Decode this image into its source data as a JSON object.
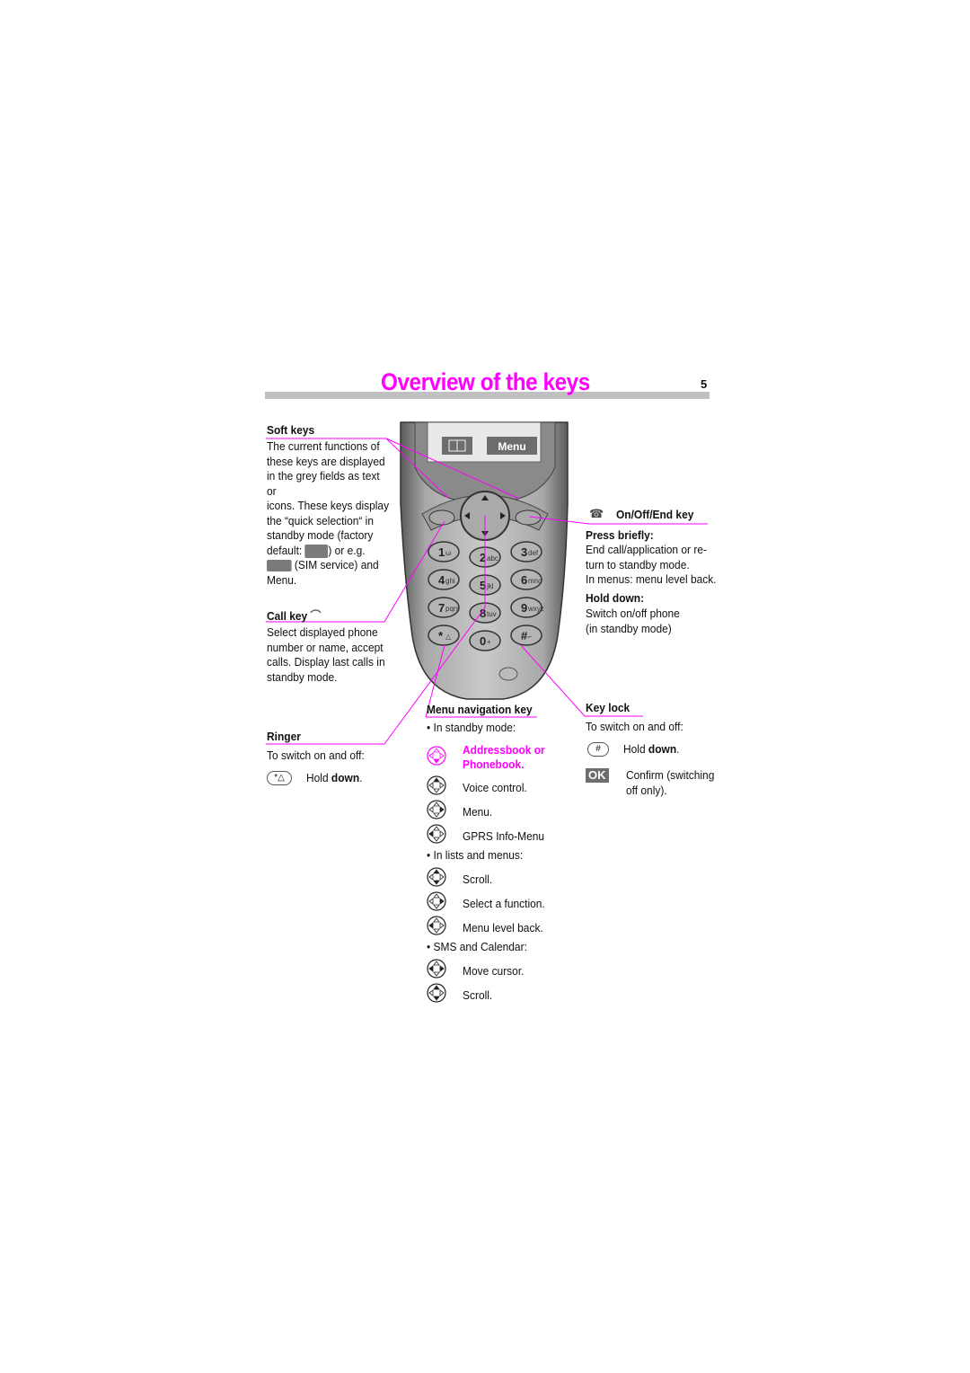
{
  "header": {
    "title": "Overview of the keys",
    "page_number": "5"
  },
  "soft_keys": {
    "heading": "Soft keys",
    "lines": [
      "The current functions of",
      "these keys are displayed",
      "in the grey fields as text or",
      "icons. These keys display",
      "the “quick selection“ in",
      "standby mode (factory"
    ],
    "default_prefix": "default:",
    "default_suffix": ") or e.g.",
    "sim_suffix": "(SIM service) and",
    "last": "Menu."
  },
  "call_key": {
    "heading": "Call key",
    "lines": [
      "Select displayed phone",
      "number or name, accept",
      "calls. Display last calls in",
      "standby mode."
    ]
  },
  "ringer": {
    "heading": "Ringer",
    "intro": "To switch on and off:",
    "action_prefix": "Hold ",
    "action_bold": "down",
    "action_suffix": "."
  },
  "phone": {
    "screen_menu_label": "Menu",
    "keys": [
      "1",
      "2",
      "3",
      "4",
      "5",
      "6",
      "7",
      "8",
      "9",
      "*",
      "0",
      "#"
    ],
    "key_letters": [
      "ω",
      "abc",
      "def",
      "ghi",
      "jkl",
      "mno",
      "pqrs",
      "tuv",
      "wxyz",
      "△",
      "+",
      "⌐"
    ]
  },
  "on_off_key": {
    "heading": "On/Off/End key",
    "press_heading": "Press briefly:",
    "press_lines": [
      "End call/application or re-",
      "turn to standby mode.",
      "In menus: menu level back."
    ],
    "hold_heading": "Hold down:",
    "hold_lines": [
      "Switch on/off phone",
      "(in standby mode)"
    ]
  },
  "key_lock": {
    "heading": "Key lock",
    "intro": "To switch on and off:",
    "hold_prefix": "Hold ",
    "hold_bold": "down",
    "hold_suffix": ".",
    "ok_label": "OK",
    "confirm_lines": [
      "Confirm (switching",
      "off only)."
    ]
  },
  "menu_nav": {
    "heading": "Menu navigation key",
    "sections": [
      {
        "bullet": "In standby mode:",
        "items": [
          {
            "dir": "down-pink",
            "label": "Addressbook or Phonebook.",
            "highlight": true
          },
          {
            "dir": "up",
            "label": "Voice control."
          },
          {
            "dir": "right",
            "label": "Menu."
          },
          {
            "dir": "left",
            "label": "GPRS Info-Menu"
          }
        ]
      },
      {
        "bullet": "In lists and menus:",
        "items": [
          {
            "dir": "updown",
            "label": "Scroll."
          },
          {
            "dir": "right",
            "label": "Select a function."
          },
          {
            "dir": "left",
            "label": "Menu level back."
          }
        ]
      },
      {
        "bullet": "SMS and Calendar:",
        "items": [
          {
            "dir": "leftright",
            "label": "Move cursor."
          },
          {
            "dir": "updown",
            "label": "Scroll."
          }
        ]
      }
    ]
  },
  "colors": {
    "accent": "#ff00ff",
    "title_bar": "#c0c0c0",
    "softkey_field": "#6d6d6d"
  }
}
